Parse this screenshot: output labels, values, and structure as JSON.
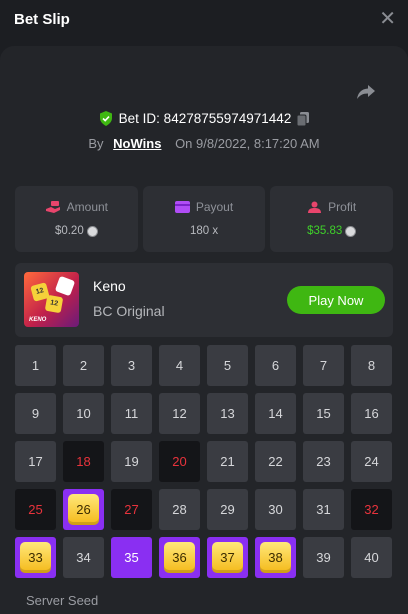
{
  "header": {
    "title": "Bet Slip",
    "close_icon": "close-icon"
  },
  "bet": {
    "id_label": "Bet ID: 84278755974971442",
    "by_label": "By",
    "username": "NoWins",
    "on_label": "On",
    "datetime": "9/8/2022, 8:17:20 AM"
  },
  "stats": [
    {
      "label": "Amount",
      "value": "$0.20",
      "icon": "money-hand-icon",
      "value_color": "#b7b9be",
      "icon_color": "#e8456c"
    },
    {
      "label": "Payout",
      "value": "180 x",
      "icon": "wallet-icon",
      "value_color": "#b7b9be",
      "icon_color": "#b04df5"
    },
    {
      "label": "Profit",
      "value": "$35.83",
      "icon": "profit-user-icon",
      "value_color": "#3fd02a",
      "icon_color": "#e8456c"
    }
  ],
  "game": {
    "name": "Keno",
    "provider": "BC Original",
    "play_label": "Play Now",
    "thumb_label": "KENO"
  },
  "grid": {
    "numbers": [
      1,
      2,
      3,
      4,
      5,
      6,
      7,
      8,
      9,
      10,
      11,
      12,
      13,
      14,
      15,
      16,
      17,
      18,
      19,
      20,
      21,
      22,
      23,
      24,
      25,
      26,
      27,
      28,
      29,
      30,
      31,
      32,
      33,
      34,
      35,
      36,
      37,
      38,
      39,
      40
    ],
    "drawn_only": [
      18,
      20,
      25,
      27,
      32
    ],
    "selected_only": [
      35
    ],
    "selected_and_drawn": [
      26,
      33,
      36,
      37,
      38
    ]
  },
  "footer": {
    "server_seed_label": "Server Seed"
  },
  "colors": {
    "accent_green": "#3fb712",
    "purple": "#8a2ff2",
    "hit_red": "#e8333c"
  }
}
